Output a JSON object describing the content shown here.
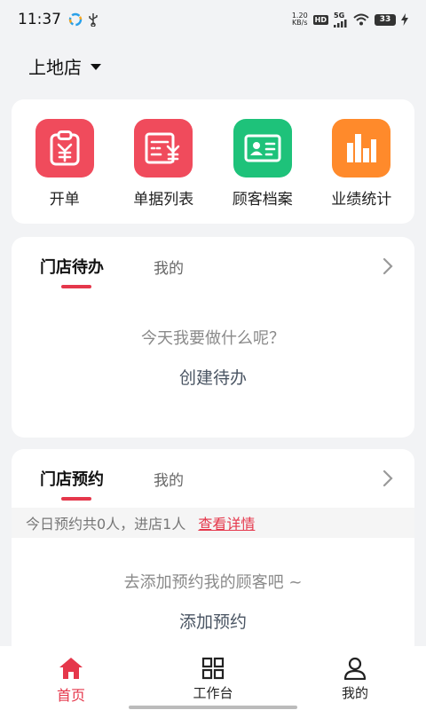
{
  "status_bar": {
    "time": "11:37",
    "net_speed_value": "1.20",
    "net_speed_unit": "KB/s",
    "hd": "HD",
    "network": "5G",
    "battery": "33"
  },
  "store": {
    "name": "上地店"
  },
  "quick_actions": [
    {
      "label": "开单",
      "icon": "clipboard-yen-icon",
      "color": "#f04b5c"
    },
    {
      "label": "单据列表",
      "icon": "receipt-list-icon",
      "color": "#f04b5c"
    },
    {
      "label": "顾客档案",
      "icon": "id-card-icon",
      "color": "#1ec27a"
    },
    {
      "label": "业绩统计",
      "icon": "bar-chart-icon",
      "color": "#ff8a2b"
    }
  ],
  "todo": {
    "tab_store": "门店待办",
    "tab_mine": "我的",
    "empty_hint": "今天我要做什么呢？",
    "action": "创建待办"
  },
  "appointment": {
    "tab_store": "门店预约",
    "tab_mine": "我的",
    "summary": "今日预约共0人，进店1人",
    "details_link": "查看详情",
    "empty_hint": "去添加预约我的顾客吧 ~",
    "action": "添加预约"
  },
  "bottom_nav": {
    "home": "首页",
    "workbench": "工作台",
    "mine": "我的"
  },
  "colors": {
    "accent": "#e5374b"
  }
}
